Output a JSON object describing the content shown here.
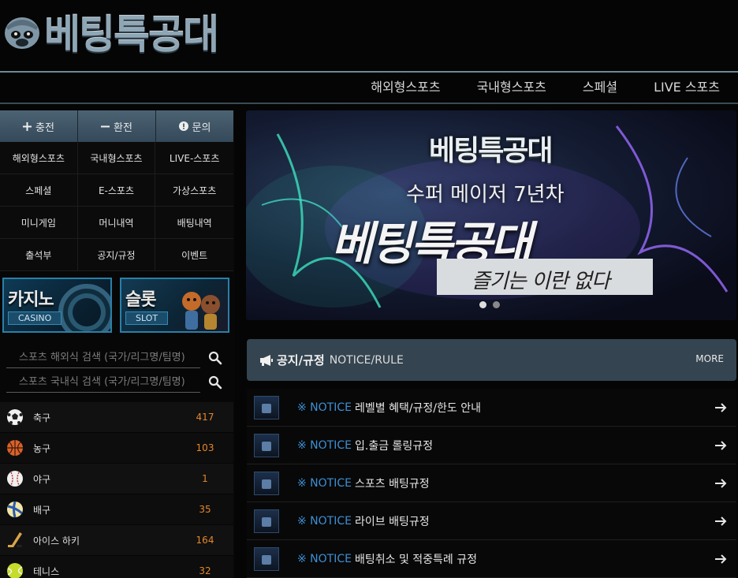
{
  "brand": {
    "name": "베팅특공대"
  },
  "topnav": {
    "items": [
      "해외형스포츠",
      "국내형스포츠",
      "스페셜",
      "LIVE 스포츠"
    ]
  },
  "actions": [
    {
      "icon": "plus-icon",
      "label": "충전"
    },
    {
      "icon": "minus-icon",
      "label": "환전"
    },
    {
      "icon": "info-icon",
      "label": "문의"
    }
  ],
  "menu": [
    "해외형스포츠",
    "국내형스포츠",
    "LIVE-스포츠",
    "스페셜",
    "E-스포츠",
    "가상스포츠",
    "미니게임",
    "머니내역",
    "배팅내역",
    "출석부",
    "공지/규정",
    "이벤트"
  ],
  "banners": {
    "casino": {
      "title": "카지노",
      "sub": "CASINO"
    },
    "slot": {
      "title": "슬롯",
      "sub": "SLOT"
    }
  },
  "search": {
    "overseas_placeholder": "스포츠 해외식 검색 (국가/리그명/팀명)",
    "domestic_placeholder": "스포츠 국내식 검색 (국가/리그명/팀명)"
  },
  "sports": [
    {
      "icon": "soccer-ball-icon",
      "name": "축구",
      "count": "417"
    },
    {
      "icon": "basketball-icon",
      "name": "농구",
      "count": "103"
    },
    {
      "icon": "baseball-icon",
      "name": "야구",
      "count": "1"
    },
    {
      "icon": "volleyball-icon",
      "name": "배구",
      "count": "35"
    },
    {
      "icon": "hockey-stick-icon",
      "name": "아이스 하키",
      "count": "164"
    },
    {
      "icon": "tennis-ball-icon",
      "name": "테니스",
      "count": "32"
    }
  ],
  "hero": {
    "logo_text": "베팅특공대",
    "tagline": "수퍼 메이저 7년차",
    "title": "베팅특공대",
    "slogan": "즐기는 이란 없다",
    "slides": 2,
    "active_slide": 0
  },
  "notice": {
    "title": "공지/규정",
    "subtitle": "NOTICE/RULE",
    "more": "MORE",
    "mark": "※ NOTICE",
    "items": [
      "레벨별 혜택/규정/한도 안내",
      "입.출금 롤링규정",
      "스포츠 배팅규정",
      "라이브 배팅규정",
      "배팅취소 및 적중특례 규정"
    ]
  },
  "colors": {
    "accent": "#3d8fd4",
    "count": "#e2862a",
    "header_bar": "#344450"
  }
}
